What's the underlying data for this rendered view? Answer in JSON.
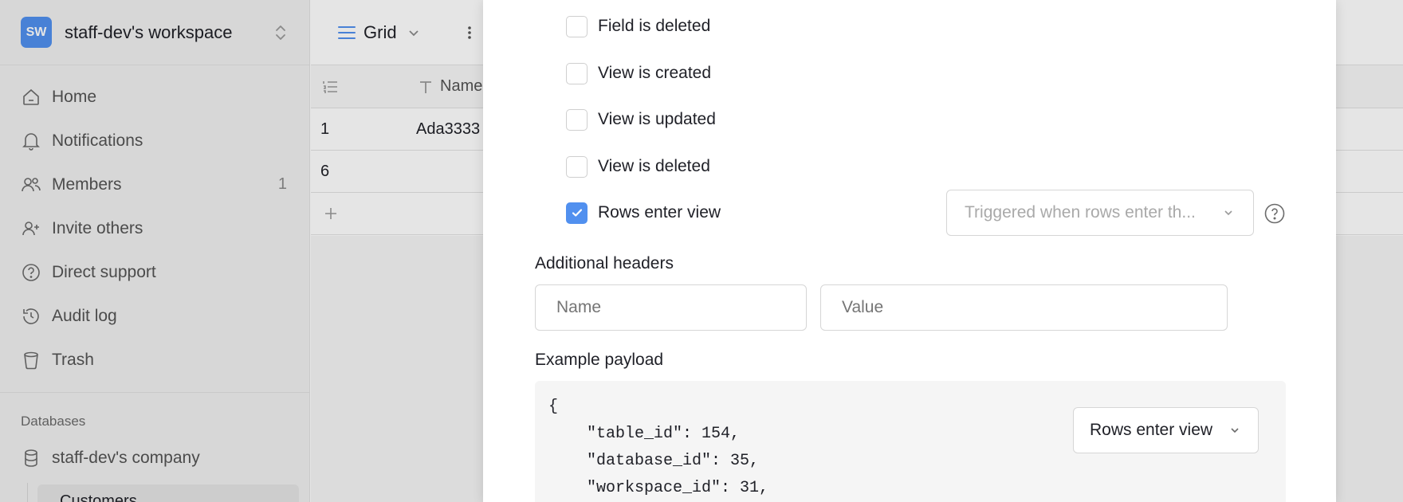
{
  "workspace": {
    "initials": "SW",
    "name": "staff-dev's workspace"
  },
  "nav": {
    "items": [
      {
        "label": "Home",
        "count": ""
      },
      {
        "label": "Notifications",
        "count": ""
      },
      {
        "label": "Members",
        "count": "1"
      },
      {
        "label": "Invite others",
        "count": ""
      },
      {
        "label": "Direct support",
        "count": ""
      },
      {
        "label": "Audit log",
        "count": ""
      },
      {
        "label": "Trash",
        "count": ""
      }
    ]
  },
  "databases": {
    "title": "Databases",
    "items": [
      {
        "label": "staff-dev's company"
      }
    ],
    "tables": [
      {
        "label": "Customers"
      }
    ]
  },
  "grid": {
    "view_label": "Grid",
    "columns": [
      "Name"
    ],
    "rows": [
      {
        "id": "1",
        "name": "Ada3333"
      },
      {
        "id": "6",
        "name": ""
      }
    ]
  },
  "webhook_form": {
    "events": [
      {
        "label": "Field is deleted",
        "checked": false
      },
      {
        "label": "View is created",
        "checked": false
      },
      {
        "label": "View is updated",
        "checked": false
      },
      {
        "label": "View is deleted",
        "checked": false
      },
      {
        "label": "Rows enter view",
        "checked": true
      }
    ],
    "view_select_placeholder": "Triggered when rows enter th...",
    "headers_label": "Additional headers",
    "header_name_placeholder": "Name",
    "header_value_placeholder": "Value",
    "payload_label": "Example payload",
    "payload_event_select": "Rows enter view",
    "payload_text": "{\n    \"table_id\": 154,\n    \"database_id\": 35,\n    \"workspace_id\": 31,"
  },
  "colors": {
    "accent": "#5190ef",
    "sidebar_bg": "#f0f0f0",
    "text": "#202128"
  }
}
